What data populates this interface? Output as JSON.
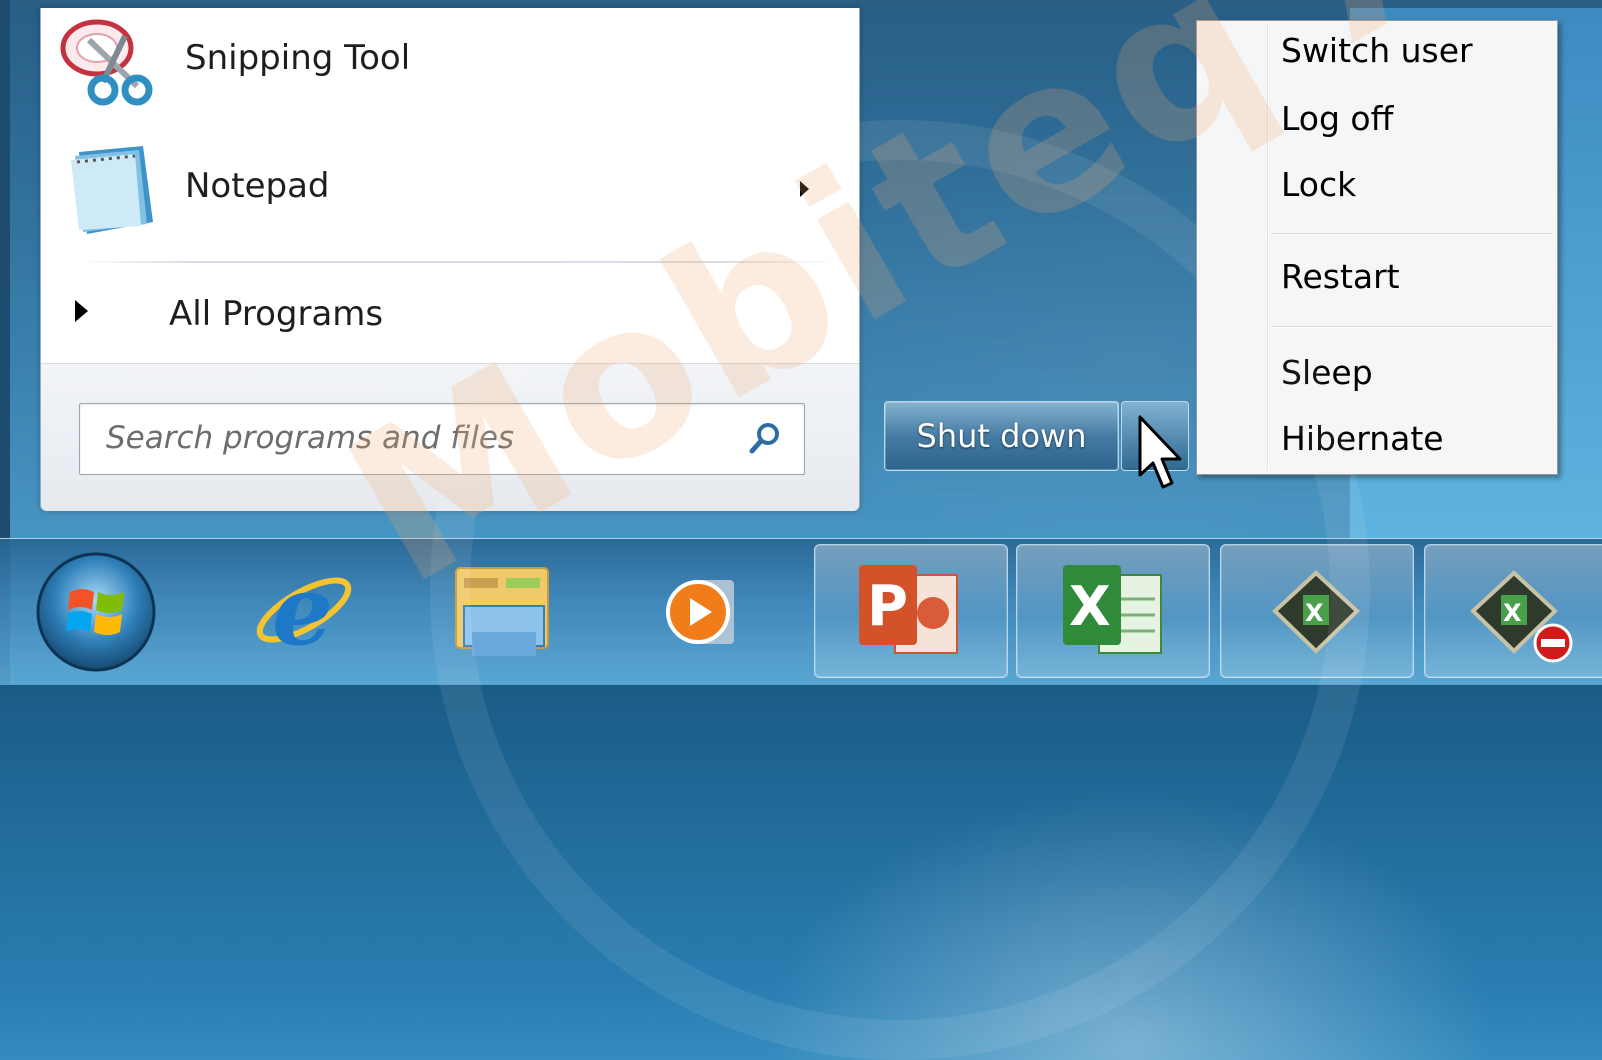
{
  "start_menu": {
    "programs": [
      {
        "label": "Snipping Tool",
        "icon": "scissors-icon",
        "has_submenu": false
      },
      {
        "label": "Notepad",
        "icon": "notepad-icon",
        "has_submenu": true
      }
    ],
    "all_programs_label": "All Programs",
    "search": {
      "placeholder": "Search programs and files",
      "icon": "search-icon"
    },
    "shutdown_label": "Shut down"
  },
  "power_menu": {
    "items": [
      "Switch user",
      "Log off",
      "Lock",
      "Restart",
      "Sleep",
      "Hibernate"
    ]
  },
  "taskbar": {
    "start_button": "windows-orb-icon",
    "pinned": [
      {
        "name": "internet-explorer-icon"
      },
      {
        "name": "windows-explorer-icon"
      },
      {
        "name": "media-player-icon"
      },
      {
        "name": "powerpoint-icon"
      },
      {
        "name": "excel-icon"
      },
      {
        "name": "excel-file-icon"
      },
      {
        "name": "excel-file-blocked-icon"
      }
    ]
  },
  "watermark": "Mobiteq Academy",
  "colors": {
    "glass": "#2a7eb2",
    "menu_bg": "#f5f6f7",
    "left_pane": "#ffffff"
  }
}
